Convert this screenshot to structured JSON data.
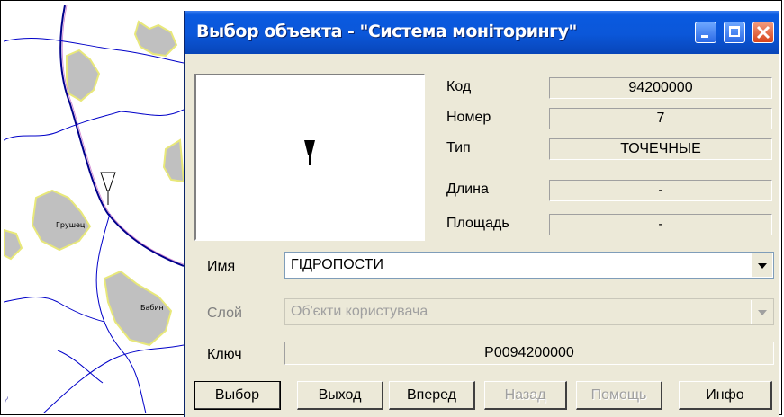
{
  "window": {
    "title": "Выбор объекта - \"Система моніторингу\"",
    "controls": [
      "minimize-icon",
      "maximize-icon",
      "close-icon"
    ]
  },
  "map": {
    "labels": [
      "Грушец",
      "Бабин"
    ]
  },
  "info": {
    "code_label": "Код",
    "code_value": "94200000",
    "number_label": "Номер",
    "number_value": "7",
    "type_label": "Тип",
    "type_value": "ТОЧЕЧНЫЕ",
    "length_label": "Длина",
    "length_value": "-",
    "area_label": "Площадь",
    "area_value": "-"
  },
  "form": {
    "name_label": "Имя",
    "name_value": "ГІДРОПОСТИ",
    "layer_label": "Слой",
    "layer_value": "Об'єкти користувача",
    "key_label": "Ключ",
    "key_value": "P0094200000"
  },
  "buttons": {
    "select": "Выбор",
    "exit": "Выход",
    "forward": "Вперед",
    "back": "Назад",
    "help": "Помощь",
    "info": "Инфо"
  },
  "colors": {
    "titlebar": "#0b57d9",
    "dialog_bg": "#ece9d8",
    "settlement": "#c0c0c0",
    "river": "#0000c8",
    "road": "#00008b"
  }
}
